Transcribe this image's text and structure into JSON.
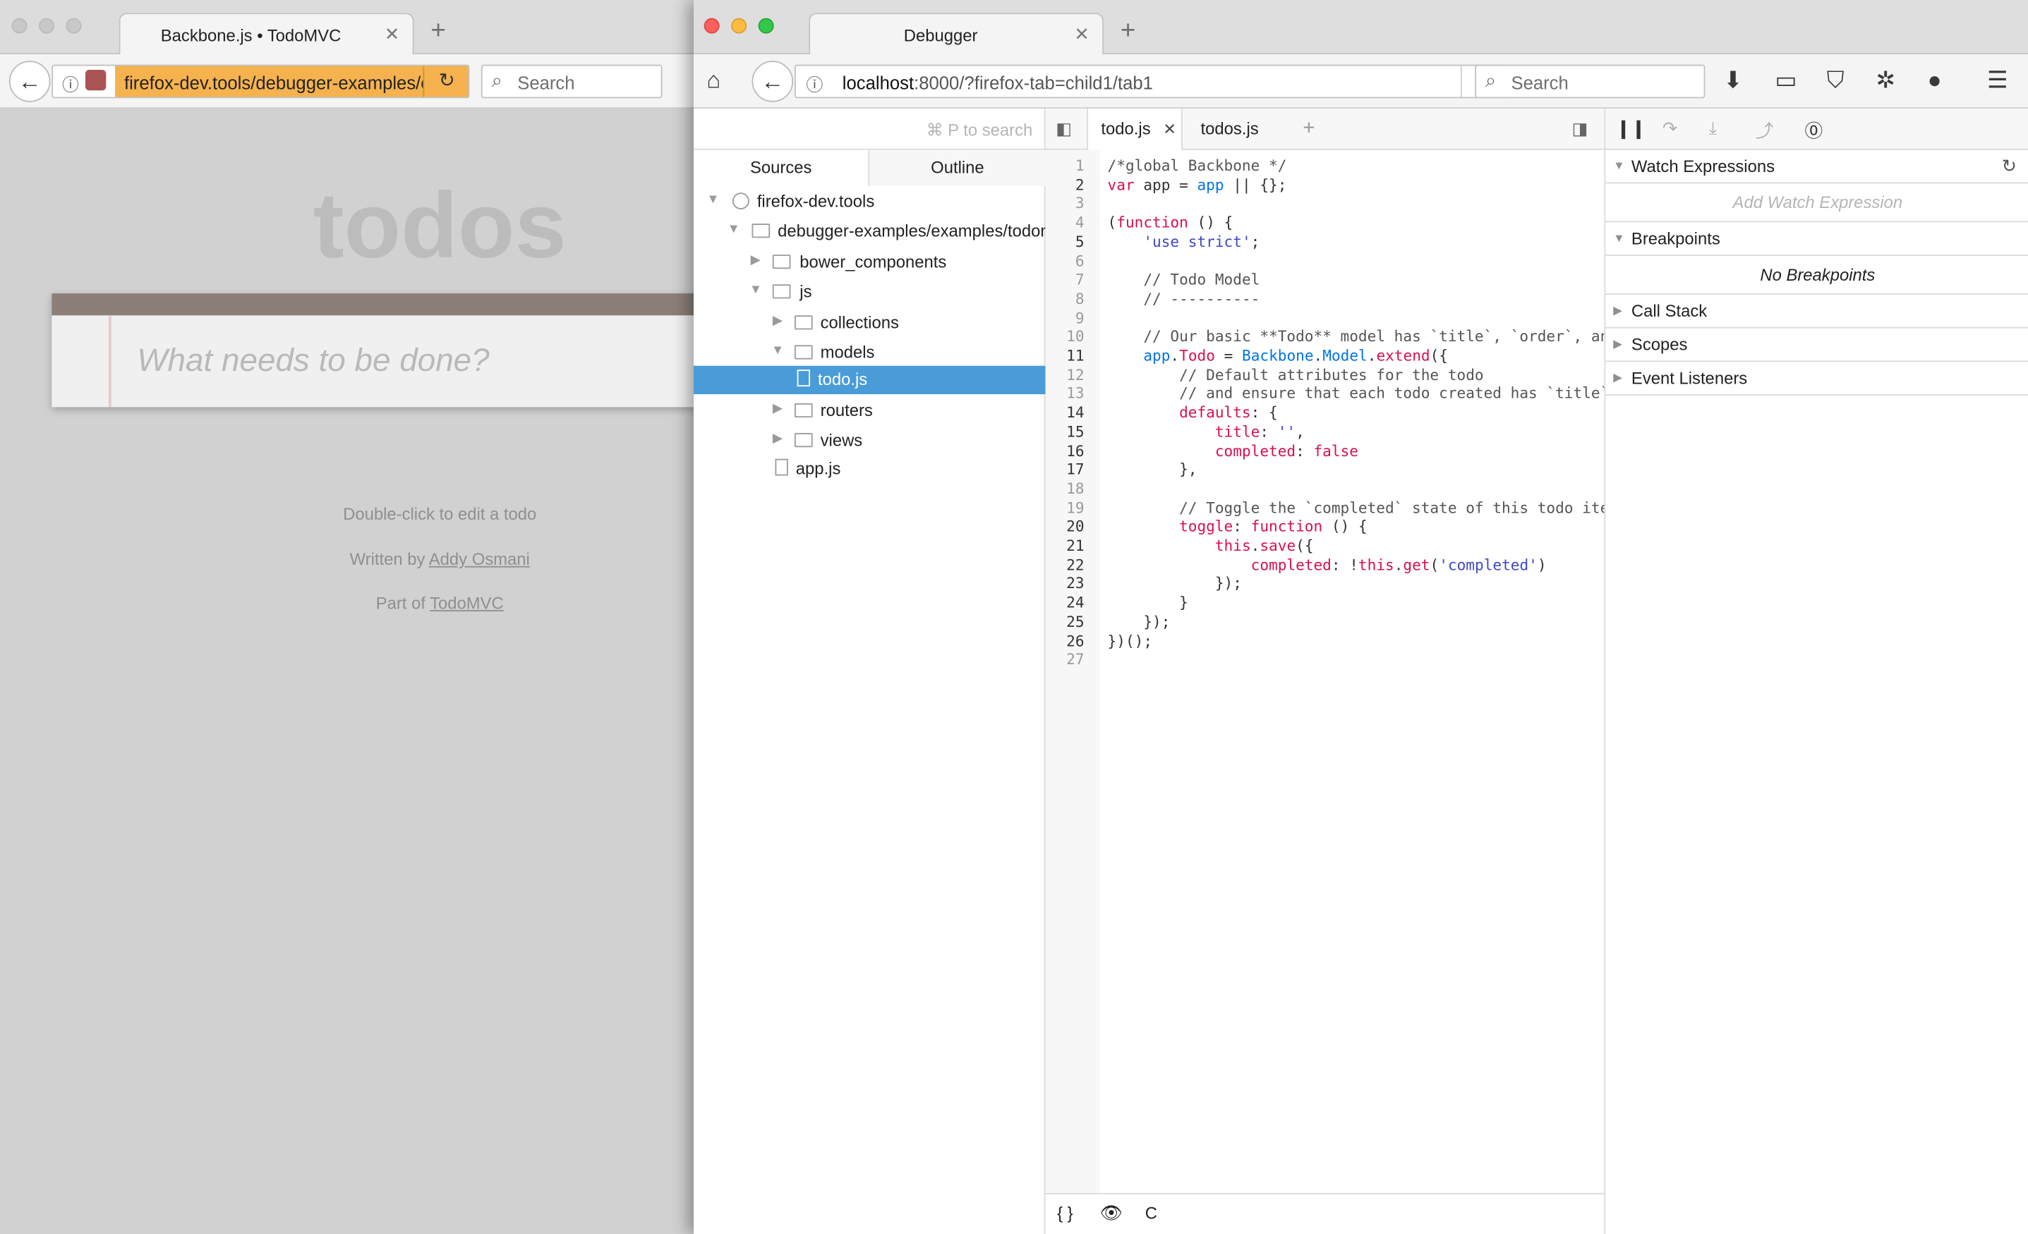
{
  "todo_window": {
    "tab_title": "Backbone.js • TodoMVC",
    "url": "firefox-dev.tools/debugger-examples/examples/todomvc/",
    "search_placeholder": "Search",
    "heading": "todos",
    "input_placeholder": "What needs to be done?",
    "footer": {
      "hint": "Double-click to edit a todo",
      "written_by": "Written by",
      "author": "Addy Osmani",
      "part_of": "Part of",
      "project": "TodoMVC"
    }
  },
  "debugger_window": {
    "tab_title": "Debugger",
    "url_host": "localhost",
    "url_rest": ":8000/?firefox-tab=child1/tab1",
    "search_placeholder": "Search"
  },
  "sources": {
    "search_hint": "⌘ P to search",
    "tabs": [
      "Sources",
      "Outline"
    ],
    "tree": [
      {
        "label": "firefox-dev.tools"
      },
      {
        "label": "debugger-examples/examples/todomvc"
      },
      {
        "label": "bower_components"
      },
      {
        "label": "js"
      },
      {
        "label": "collections"
      },
      {
        "label": "models"
      },
      {
        "label": "todo.js"
      },
      {
        "label": "routers"
      },
      {
        "label": "views"
      },
      {
        "label": "app.js"
      }
    ]
  },
  "editor": {
    "tabs": [
      "todo.js",
      "todos.js"
    ],
    "new_tab": "+",
    "footer": {
      "pretty_print": "{ }",
      "toggle": "C"
    },
    "line_numbers": [
      "1",
      "2",
      "3",
      "4",
      "5",
      "6",
      "7",
      "8",
      "9",
      "10",
      "11",
      "12",
      "13",
      "14",
      "15",
      "16",
      "17",
      "18",
      "19",
      "20",
      "21",
      "22",
      "23",
      "24",
      "25",
      "26",
      "27"
    ]
  },
  "right_pane": {
    "watch": {
      "label": "Watch Expressions",
      "placeholder": "Add Watch Expression"
    },
    "breakpoints": {
      "label": "Breakpoints",
      "empty": "No Breakpoints"
    },
    "sections": [
      "Call Stack",
      "Scopes",
      "Event Listeners"
    ]
  },
  "colors": {
    "selection": "#4a9cd9",
    "keyword": "#d7114d",
    "identifier": "#0074e8",
    "string": "#3d47c7",
    "todo_bar": "#8b7f78",
    "url_highlight": "#f5b24e"
  },
  "icons": {
    "back": "back-arrow-icon",
    "reload": "reload-icon",
    "search": "search-icon",
    "home": "home-icon",
    "download": "download-icon",
    "sidebar": "sidebar-icon",
    "pocket": "pocket-icon",
    "menu": "hamburger-menu-icon"
  }
}
